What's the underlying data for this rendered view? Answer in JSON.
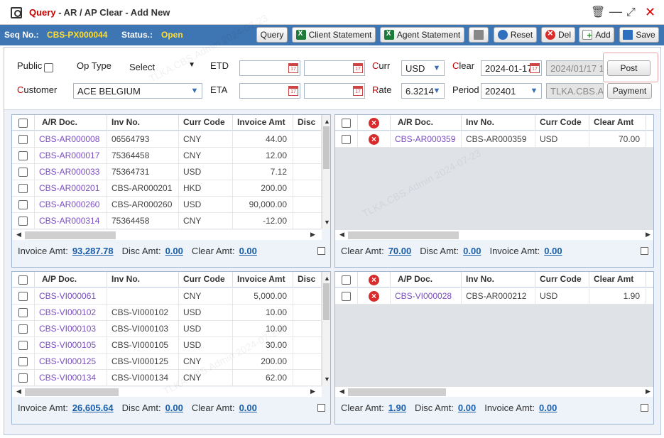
{
  "window": {
    "title_query": "Query",
    "title_rest": " - AR / AP Clear - Add New"
  },
  "toolbar": {
    "seq_label": "Seq No.:",
    "seq_value": "CBS-PX000044",
    "status_label": "Status.:",
    "status_value": "Open",
    "query": "Query",
    "client_statement": "Client Statement",
    "agent_statement": "Agent Statement",
    "reset": "Reset",
    "del": "Del",
    "add": "Add",
    "save": "Save"
  },
  "form": {
    "public": "Public",
    "op_type": "Op Type",
    "op_type_value": "Select",
    "etd": "ETD",
    "eta": "ETA",
    "curr_first": "C",
    "curr_rest": "urr",
    "curr_value": "USD",
    "clear_first": "C",
    "clear_rest": "lear",
    "clear_date": "2024-01-17",
    "clear_date2": "2024/01/17 1",
    "post": "Post",
    "customer_first": "C",
    "customer_rest": "ustomer",
    "customer_value": "ACE BELGIUM",
    "rate_first": "R",
    "rate_rest": "ate",
    "rate_value": "6.3214",
    "period": "Period",
    "period_value": "202401",
    "user": "TLKA.CBS.A",
    "payment": "Payment"
  },
  "ar_table": {
    "headers": [
      "A/R Doc.",
      "Inv No.",
      "Curr Code",
      "Invoice Amt",
      "Disc"
    ],
    "rows": [
      [
        "CBS-AR000008",
        "06564793",
        "CNY",
        "44.00"
      ],
      [
        "CBS-AR000017",
        "75364458",
        "CNY",
        "12.00"
      ],
      [
        "CBS-AR000033",
        "75364731",
        "USD",
        "7.12"
      ],
      [
        "CBS-AR000201",
        "CBS-AR000201",
        "HKD",
        "200.00"
      ],
      [
        "CBS-AR000260",
        "CBS-AR000260",
        "USD",
        "90,000.00"
      ],
      [
        "CBS-AR000314",
        "75364458",
        "CNY",
        "-12.00"
      ]
    ],
    "footer": {
      "inv_label": "Invoice Amt:",
      "inv": "93,287.78",
      "disc_label": "Disc Amt:",
      "disc": "0.00",
      "clear_label": "Clear Amt:",
      "clear": "0.00"
    }
  },
  "ar_clear_table": {
    "headers": [
      "A/R Doc.",
      "Inv No.",
      "Curr Code",
      "Clear Amt"
    ],
    "rows": [
      [
        "CBS-AR000359",
        "CBS-AR000359",
        "USD",
        "70.00"
      ]
    ],
    "footer": {
      "clear_label": "Clear Amt:",
      "clear": "70.00",
      "disc_label": "Disc Amt:",
      "disc": "0.00",
      "inv_label": "Invoice Amt:",
      "inv": "0.00"
    }
  },
  "ap_table": {
    "headers": [
      "A/P Doc.",
      "Inv No.",
      "Curr Code",
      "Invoice Amt",
      "Disc"
    ],
    "rows": [
      [
        "CBS-VI000061",
        "",
        "CNY",
        "5,000.00"
      ],
      [
        "CBS-VI000102",
        "CBS-VI000102",
        "USD",
        "10.00"
      ],
      [
        "CBS-VI000103",
        "CBS-VI000103",
        "USD",
        "10.00"
      ],
      [
        "CBS-VI000105",
        "CBS-VI000105",
        "USD",
        "30.00"
      ],
      [
        "CBS-VI000125",
        "CBS-VI000125",
        "CNY",
        "200.00"
      ],
      [
        "CBS-VI000134",
        "CBS-VI000134",
        "CNY",
        "62.00"
      ]
    ],
    "footer": {
      "inv_label": "Invoice Amt:",
      "inv": "26,605.64",
      "disc_label": "Disc Amt:",
      "disc": "0.00",
      "clear_label": "Clear Amt:",
      "clear": "0.00"
    }
  },
  "ap_clear_table": {
    "headers": [
      "A/P Doc.",
      "Inv No.",
      "Curr Code",
      "Clear Amt"
    ],
    "rows": [
      [
        "CBS-VI000028",
        "CBS-AR000212",
        "USD",
        "1.90"
      ]
    ],
    "footer": {
      "clear_label": "Clear Amt:",
      "clear": "1.90",
      "disc_label": "Disc Amt:",
      "disc": "0.00",
      "inv_label": "Invoice Amt:",
      "inv": "0.00"
    }
  },
  "watermark": "TLKA.CBS.Admin 2024-07-23",
  "colors": {
    "accent": "#3e75b3",
    "title_red": "#c00000",
    "link": "#7a4fc0",
    "status": "#ffdd33"
  }
}
